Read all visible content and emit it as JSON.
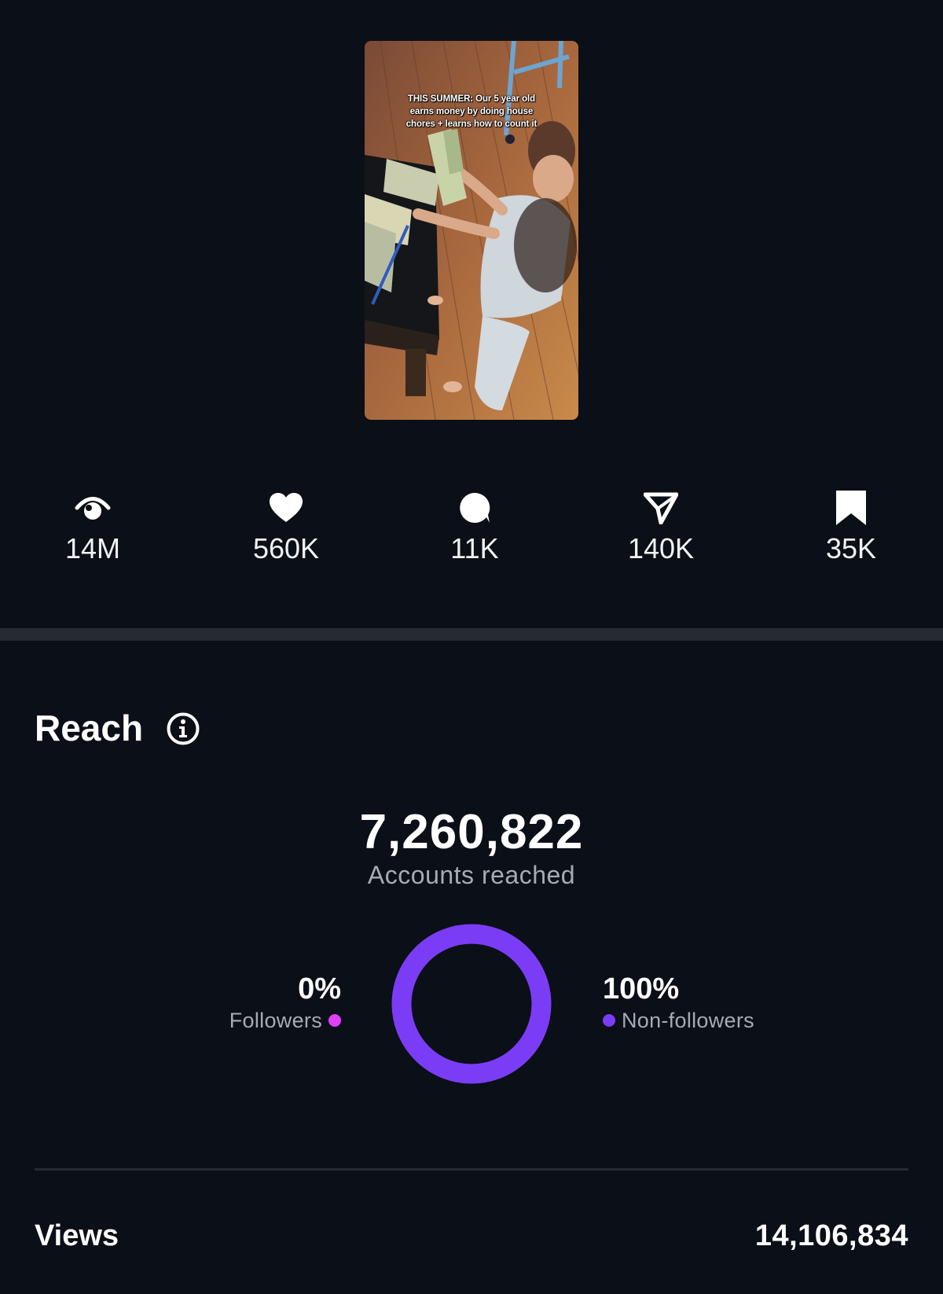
{
  "post": {
    "thumbnail_caption": "THIS SUMMER: Our 5 year old earns money by doing house chores + learns how to count it"
  },
  "stats": [
    {
      "icon": "eye-icon",
      "value": "14M"
    },
    {
      "icon": "heart-icon",
      "value": "560K"
    },
    {
      "icon": "comment-icon",
      "value": "11K"
    },
    {
      "icon": "share-icon",
      "value": "140K"
    },
    {
      "icon": "bookmark-icon",
      "value": "35K"
    }
  ],
  "reach": {
    "title": "Reach",
    "accounts_reached": "7,260,822",
    "accounts_reached_label": "Accounts reached",
    "followers": {
      "percent": "0%",
      "label": "Followers",
      "color": "#e040fb",
      "fraction": 0.0
    },
    "non_followers": {
      "percent": "100%",
      "label": "Non-followers",
      "color": "#7b3cf6",
      "fraction": 1.0
    }
  },
  "views": {
    "label": "Views",
    "value": "14,106,834"
  },
  "colors": {
    "background": "#0b0f17",
    "divider": "#262a33",
    "secondary_text": "#a6abb5"
  }
}
